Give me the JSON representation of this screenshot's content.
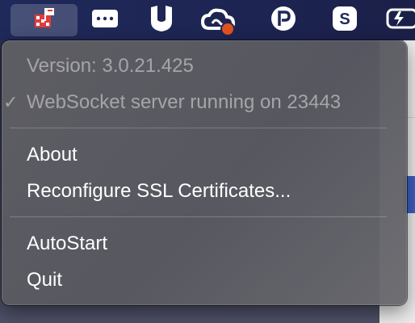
{
  "menubar": {
    "icons": [
      {
        "name": "printer-flag-app-icon"
      },
      {
        "name": "window-dots-icon"
      },
      {
        "name": "u-shield-icon"
      },
      {
        "name": "creative-cloud-icon"
      },
      {
        "name": "p-circle-icon"
      },
      {
        "name": "s-square-icon"
      },
      {
        "name": "battery-icon"
      }
    ],
    "notification_color": "#e0531f"
  },
  "menu": {
    "version": "Version: 3.0.21.425",
    "check_mark": "✓",
    "websocket_status": "WebSocket server running on 23443",
    "about": "About",
    "reconfigure_ssl": "Reconfigure SSL Certificates...",
    "autostart": "AutoStart",
    "quit": "Quit"
  }
}
